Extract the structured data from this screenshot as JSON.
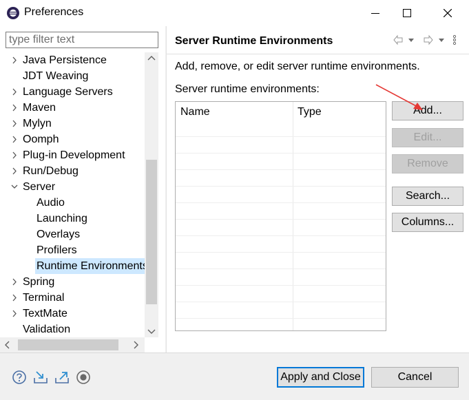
{
  "window": {
    "title": "Preferences"
  },
  "sidebar": {
    "filter_placeholder": "type filter text",
    "items": [
      {
        "label": "Java Persistence",
        "level": 0,
        "expandable": true,
        "expanded": false
      },
      {
        "label": "JDT Weaving",
        "level": 0,
        "expandable": false
      },
      {
        "label": "Language Servers",
        "level": 0,
        "expandable": true,
        "expanded": false
      },
      {
        "label": "Maven",
        "level": 0,
        "expandable": true,
        "expanded": false
      },
      {
        "label": "Mylyn",
        "level": 0,
        "expandable": true,
        "expanded": false
      },
      {
        "label": "Oomph",
        "level": 0,
        "expandable": true,
        "expanded": false
      },
      {
        "label": "Plug-in Development",
        "level": 0,
        "expandable": true,
        "expanded": false
      },
      {
        "label": "Run/Debug",
        "level": 0,
        "expandable": true,
        "expanded": false
      },
      {
        "label": "Server",
        "level": 0,
        "expandable": true,
        "expanded": true
      },
      {
        "label": "Audio",
        "level": 1,
        "expandable": false
      },
      {
        "label": "Launching",
        "level": 1,
        "expandable": false
      },
      {
        "label": "Overlays",
        "level": 1,
        "expandable": false
      },
      {
        "label": "Profilers",
        "level": 1,
        "expandable": false
      },
      {
        "label": "Runtime Environments",
        "level": 1,
        "expandable": false,
        "selected": true
      },
      {
        "label": "Spring",
        "level": 0,
        "expandable": true,
        "expanded": false
      },
      {
        "label": "Terminal",
        "level": 0,
        "expandable": true,
        "expanded": false
      },
      {
        "label": "TextMate",
        "level": 0,
        "expandable": true,
        "expanded": false
      },
      {
        "label": "Validation",
        "level": 0,
        "expandable": false
      }
    ]
  },
  "page": {
    "title": "Server Runtime Environments",
    "description": "Add, remove, or edit server runtime environments.",
    "list_label": "Server runtime environments:",
    "table": {
      "columns": [
        "Name",
        "Type"
      ],
      "rows": []
    },
    "buttons": {
      "add": "Add...",
      "edit": "Edit...",
      "remove": "Remove",
      "search": "Search...",
      "columns": "Columns..."
    }
  },
  "footer": {
    "apply_close": "Apply and Close",
    "cancel": "Cancel"
  },
  "colors": {
    "selection": "#cde8ff",
    "accent": "#0078d7",
    "annotation_arrow": "#e53935"
  },
  "icons": [
    "eclipse-icon",
    "help-icon",
    "import-icon",
    "export-icon",
    "oomph-record-icon"
  ]
}
